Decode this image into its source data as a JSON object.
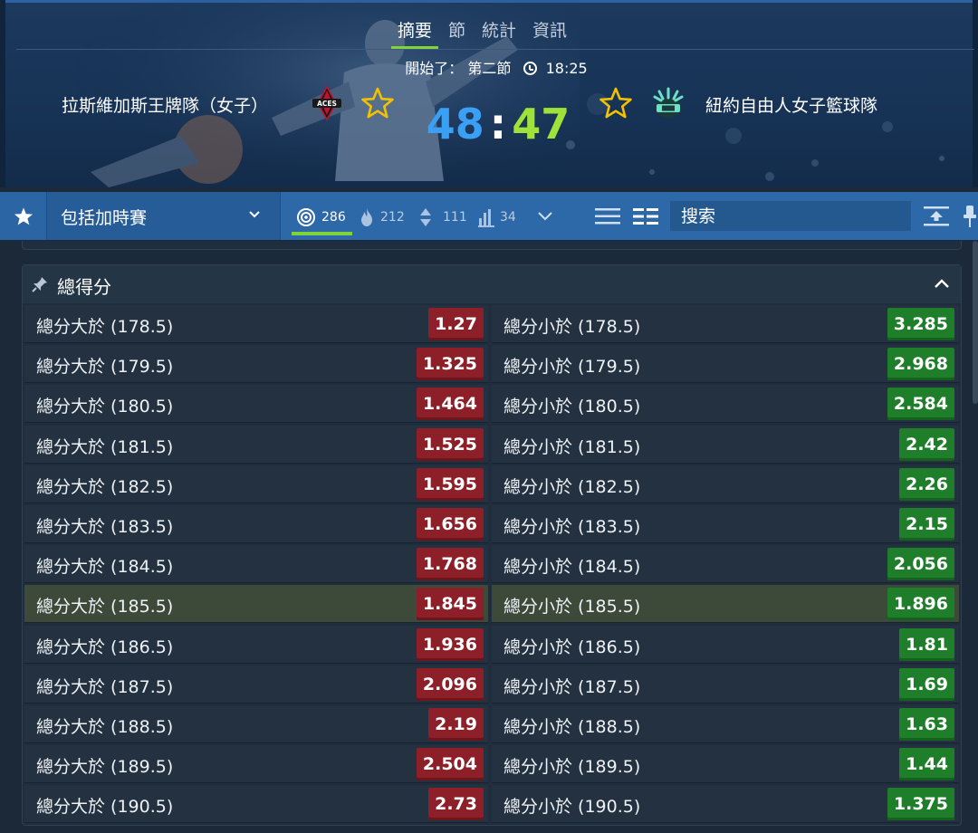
{
  "header": {
    "tabs": [
      {
        "label": "摘要",
        "active": true
      },
      {
        "label": "節",
        "active": false
      },
      {
        "label": "統計",
        "active": false
      },
      {
        "label": "資訊",
        "active": false
      }
    ],
    "status_prefix": "開始了：",
    "period": "第二節",
    "clock": "18:25",
    "home_team": "拉斯維加斯王牌隊（女子）",
    "away_team": "紐約自由人女子籃球隊",
    "home_logo_text": "ACES",
    "home_score": "48",
    "score_separator": ":",
    "away_score": "47",
    "colors": {
      "home_score": "#3aa0f5",
      "away_score": "#9fe23a",
      "active_tab_underline": "#7fd43a"
    }
  },
  "toolbar": {
    "period_select": "包括加時賽",
    "filters": [
      {
        "icon": "target-icon",
        "count": "286",
        "active": true
      },
      {
        "icon": "fire-icon",
        "count": "212",
        "active": false
      },
      {
        "icon": "updown-icon",
        "count": "111",
        "active": false
      },
      {
        "icon": "bar-chart-icon",
        "count": "34",
        "active": false
      }
    ],
    "search_placeholder": "搜索"
  },
  "market": {
    "title": "總得分",
    "rows": [
      {
        "over_label": "總分大於 (178.5)",
        "over_odds": "1.27",
        "under_label": "總分小於 (178.5)",
        "under_odds": "3.285",
        "highlight": false
      },
      {
        "over_label": "總分大於 (179.5)",
        "over_odds": "1.325",
        "under_label": "總分小於 (179.5)",
        "under_odds": "2.968",
        "highlight": false
      },
      {
        "over_label": "總分大於 (180.5)",
        "over_odds": "1.464",
        "under_label": "總分小於 (180.5)",
        "under_odds": "2.584",
        "highlight": false
      },
      {
        "over_label": "總分大於 (181.5)",
        "over_odds": "1.525",
        "under_label": "總分小於 (181.5)",
        "under_odds": "2.42",
        "highlight": false
      },
      {
        "over_label": "總分大於 (182.5)",
        "over_odds": "1.595",
        "under_label": "總分小於 (182.5)",
        "under_odds": "2.26",
        "highlight": false
      },
      {
        "over_label": "總分大於 (183.5)",
        "over_odds": "1.656",
        "under_label": "總分小於 (183.5)",
        "under_odds": "2.15",
        "highlight": false
      },
      {
        "over_label": "總分大於 (184.5)",
        "over_odds": "1.768",
        "under_label": "總分小於 (184.5)",
        "under_odds": "2.056",
        "highlight": false
      },
      {
        "over_label": "總分大於 (185.5)",
        "over_odds": "1.845",
        "under_label": "總分小於 (185.5)",
        "under_odds": "1.896",
        "highlight": true
      },
      {
        "over_label": "總分大於 (186.5)",
        "over_odds": "1.936",
        "under_label": "總分小於 (186.5)",
        "under_odds": "1.81",
        "highlight": false
      },
      {
        "over_label": "總分大於 (187.5)",
        "over_odds": "2.096",
        "under_label": "總分小於 (187.5)",
        "under_odds": "1.69",
        "highlight": false
      },
      {
        "over_label": "總分大於 (188.5)",
        "over_odds": "2.19",
        "under_label": "總分小於 (188.5)",
        "under_odds": "1.63",
        "highlight": false
      },
      {
        "over_label": "總分大於 (189.5)",
        "over_odds": "2.504",
        "under_label": "總分小於 (189.5)",
        "under_odds": "1.44",
        "highlight": false
      },
      {
        "over_label": "總分大於 (190.5)",
        "over_odds": "2.73",
        "under_label": "總分小於 (190.5)",
        "under_odds": "1.375",
        "highlight": false
      }
    ],
    "colors": {
      "over_odds": "#8c1f27",
      "under_odds": "#1f7e2a",
      "highlight_row": "#3d4a3a"
    }
  }
}
